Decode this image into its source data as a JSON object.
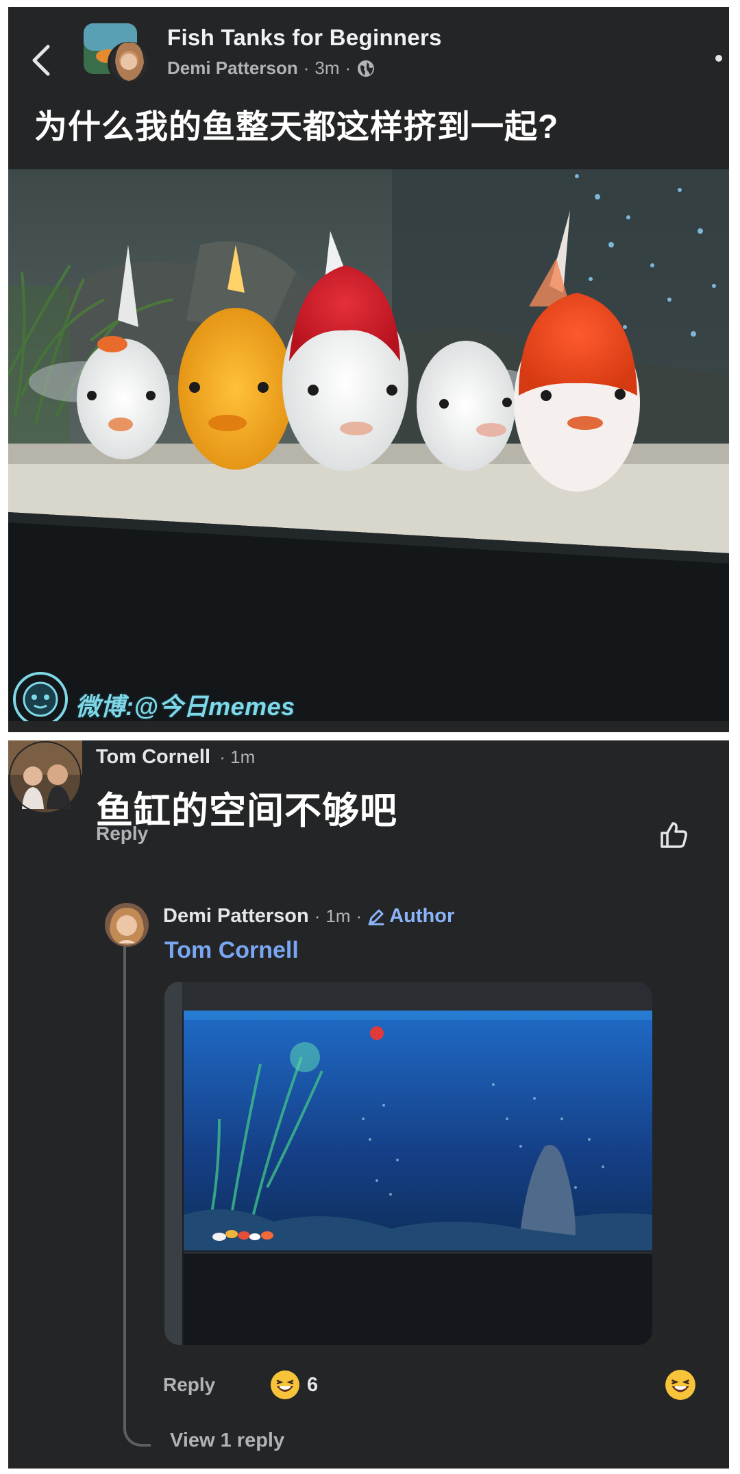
{
  "post": {
    "group_name": "Fish Tanks for Beginners",
    "author": "Demi Patterson",
    "time": "3m",
    "text": "为什么我的鱼整天都这样挤到一起?",
    "image_watermark": "微博:@今日memes",
    "icons": [
      "back-arrow-icon",
      "globe-icon",
      "more-dot-icon"
    ]
  },
  "comment": {
    "author": "Tom Cornell",
    "time": "1m",
    "text": "鱼缸的空间不够吧",
    "reply_label": "Reply",
    "icons": [
      "like-icon"
    ]
  },
  "reply": {
    "author": "Demi Patterson",
    "time": "1m",
    "author_badge": "Author",
    "mention": "Tom Cornell",
    "reply_label": "Reply",
    "reaction_count": "6",
    "view_replies_label": "View 1 reply",
    "icons": [
      "pencil-icon",
      "laugh-emoji-icon"
    ]
  },
  "colors": {
    "panel_bg": "#242526",
    "primary_text": "#e4e6eb",
    "secondary_text": "#b0b3b8",
    "link_blue": "#7aa7f3",
    "watermark": "#7fd8e8"
  }
}
